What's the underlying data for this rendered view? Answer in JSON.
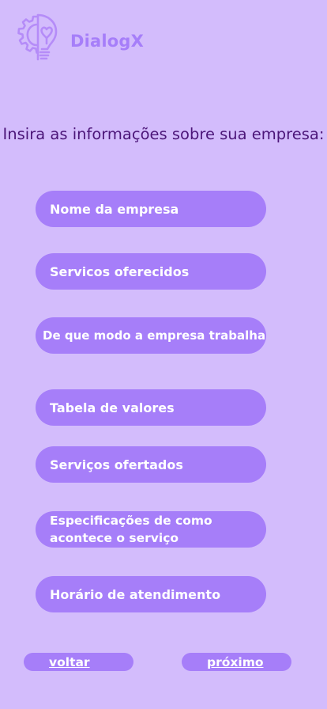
{
  "brand": {
    "name": "DialogX"
  },
  "form": {
    "heading": "Insira as informações sobre sua empresa:",
    "fields": [
      {
        "label": "Nome da empresa"
      },
      {
        "label": "Servicos oferecidos"
      },
      {
        "label": "De que modo a empresa trabalha"
      },
      {
        "label": "Tabela de valores"
      },
      {
        "label": "Serviços ofertados"
      },
      {
        "label": "Especificações de como acontece o serviço"
      },
      {
        "label": "Horário de atendimento"
      }
    ]
  },
  "nav": {
    "back_label": "voltar",
    "next_label": "próximo"
  },
  "colors": {
    "background": "#d3bcfc",
    "accent": "#a67ef9",
    "heading_text": "#4c1679",
    "button_text": "#ffffff"
  },
  "icons": {
    "logo": "gear-lightbulb-icon"
  }
}
